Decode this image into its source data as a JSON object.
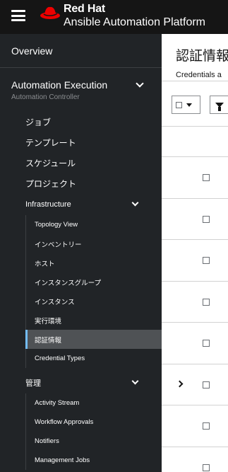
{
  "masthead": {
    "brand_line1": "Red Hat",
    "brand_line2": "Ansible Automation Platform",
    "accent_color": "#ee0000"
  },
  "sidebar": {
    "overview": "Overview",
    "group": {
      "title": "Automation Execution",
      "subtitle": "Automation Controller"
    },
    "items": [
      {
        "label": "ジョブ"
      },
      {
        "label": "テンプレート"
      },
      {
        "label": "スケジュール"
      },
      {
        "label": "プロジェクト"
      }
    ],
    "infrastructure": {
      "label": "Infrastructure",
      "items": [
        {
          "label": "Topology View"
        },
        {
          "label": "インベントリー"
        },
        {
          "label": "ホスト"
        },
        {
          "label": "インスタンスグループ"
        },
        {
          "label": "インスタンス"
        },
        {
          "label": "実行環境"
        },
        {
          "label": "認証情報",
          "active": true
        },
        {
          "label": "Credential Types"
        }
      ]
    },
    "admin": {
      "label": "管理",
      "items": [
        {
          "label": "Activity Stream"
        },
        {
          "label": "Workflow Approvals"
        },
        {
          "label": "Notifiers"
        },
        {
          "label": "Management Jobs"
        }
      ]
    }
  },
  "main": {
    "title": "認証情報",
    "description": "Credentials a",
    "toolbar": {
      "bulk_select_icon": "checkbox-icon",
      "filter_icon": "filter-icon"
    },
    "rows": [
      {
        "expandable": false
      },
      {
        "expandable": false
      },
      {
        "expandable": false
      },
      {
        "expandable": false
      },
      {
        "expandable": false
      },
      {
        "expandable": true
      },
      {
        "expandable": false
      },
      {
        "expandable": false
      }
    ]
  }
}
